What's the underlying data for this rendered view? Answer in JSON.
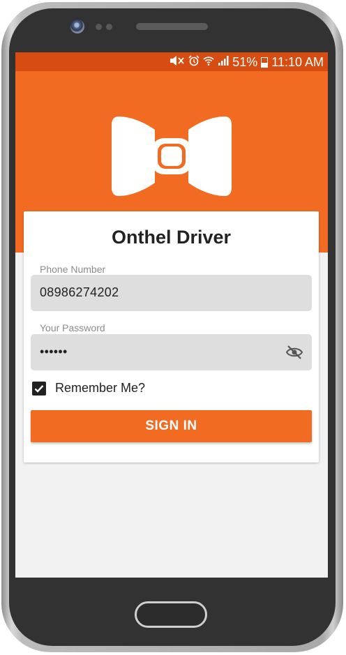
{
  "status_bar": {
    "battery": "51%",
    "time": "11:10 AM",
    "icons": [
      "mute-icon",
      "alarm-icon",
      "wifi-icon",
      "signal-icon",
      "battery-icon"
    ]
  },
  "app": {
    "title": "Onthel Driver",
    "logo": "bowtie-logo"
  },
  "login": {
    "phone_label": "Phone Number",
    "phone_value": "08986274202",
    "password_label": "Your Password",
    "password_value": "••••••",
    "remember_label": "Remember Me?",
    "remember_checked": true,
    "signin_label": "SIGN IN"
  },
  "colors": {
    "primary": "#f26b22",
    "status_bar": "#d74c10",
    "background": "#f2f2f2"
  }
}
